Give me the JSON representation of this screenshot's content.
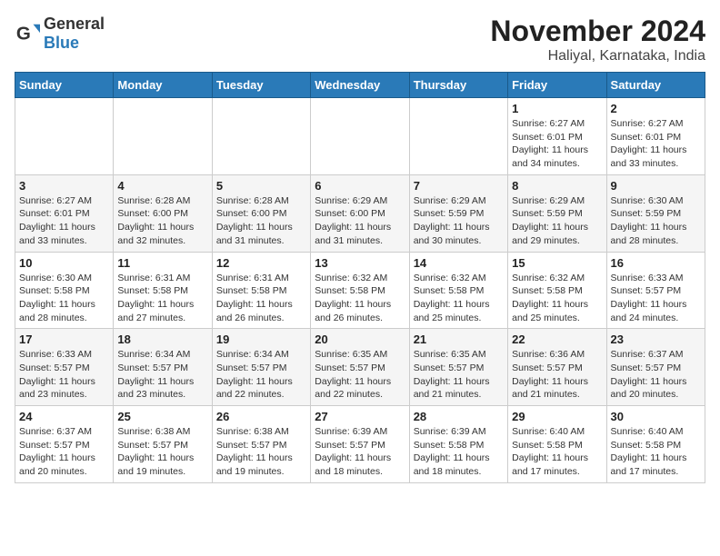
{
  "logo": {
    "text_general": "General",
    "text_blue": "Blue"
  },
  "title": "November 2024",
  "subtitle": "Haliyal, Karnataka, India",
  "weekdays": [
    "Sunday",
    "Monday",
    "Tuesday",
    "Wednesday",
    "Thursday",
    "Friday",
    "Saturday"
  ],
  "weeks": [
    [
      {
        "day": "",
        "info": ""
      },
      {
        "day": "",
        "info": ""
      },
      {
        "day": "",
        "info": ""
      },
      {
        "day": "",
        "info": ""
      },
      {
        "day": "",
        "info": ""
      },
      {
        "day": "1",
        "info": "Sunrise: 6:27 AM\nSunset: 6:01 PM\nDaylight: 11 hours and 34 minutes."
      },
      {
        "day": "2",
        "info": "Sunrise: 6:27 AM\nSunset: 6:01 PM\nDaylight: 11 hours and 33 minutes."
      }
    ],
    [
      {
        "day": "3",
        "info": "Sunrise: 6:27 AM\nSunset: 6:01 PM\nDaylight: 11 hours and 33 minutes."
      },
      {
        "day": "4",
        "info": "Sunrise: 6:28 AM\nSunset: 6:00 PM\nDaylight: 11 hours and 32 minutes."
      },
      {
        "day": "5",
        "info": "Sunrise: 6:28 AM\nSunset: 6:00 PM\nDaylight: 11 hours and 31 minutes."
      },
      {
        "day": "6",
        "info": "Sunrise: 6:29 AM\nSunset: 6:00 PM\nDaylight: 11 hours and 31 minutes."
      },
      {
        "day": "7",
        "info": "Sunrise: 6:29 AM\nSunset: 5:59 PM\nDaylight: 11 hours and 30 minutes."
      },
      {
        "day": "8",
        "info": "Sunrise: 6:29 AM\nSunset: 5:59 PM\nDaylight: 11 hours and 29 minutes."
      },
      {
        "day": "9",
        "info": "Sunrise: 6:30 AM\nSunset: 5:59 PM\nDaylight: 11 hours and 28 minutes."
      }
    ],
    [
      {
        "day": "10",
        "info": "Sunrise: 6:30 AM\nSunset: 5:58 PM\nDaylight: 11 hours and 28 minutes."
      },
      {
        "day": "11",
        "info": "Sunrise: 6:31 AM\nSunset: 5:58 PM\nDaylight: 11 hours and 27 minutes."
      },
      {
        "day": "12",
        "info": "Sunrise: 6:31 AM\nSunset: 5:58 PM\nDaylight: 11 hours and 26 minutes."
      },
      {
        "day": "13",
        "info": "Sunrise: 6:32 AM\nSunset: 5:58 PM\nDaylight: 11 hours and 26 minutes."
      },
      {
        "day": "14",
        "info": "Sunrise: 6:32 AM\nSunset: 5:58 PM\nDaylight: 11 hours and 25 minutes."
      },
      {
        "day": "15",
        "info": "Sunrise: 6:32 AM\nSunset: 5:58 PM\nDaylight: 11 hours and 25 minutes."
      },
      {
        "day": "16",
        "info": "Sunrise: 6:33 AM\nSunset: 5:57 PM\nDaylight: 11 hours and 24 minutes."
      }
    ],
    [
      {
        "day": "17",
        "info": "Sunrise: 6:33 AM\nSunset: 5:57 PM\nDaylight: 11 hours and 23 minutes."
      },
      {
        "day": "18",
        "info": "Sunrise: 6:34 AM\nSunset: 5:57 PM\nDaylight: 11 hours and 23 minutes."
      },
      {
        "day": "19",
        "info": "Sunrise: 6:34 AM\nSunset: 5:57 PM\nDaylight: 11 hours and 22 minutes."
      },
      {
        "day": "20",
        "info": "Sunrise: 6:35 AM\nSunset: 5:57 PM\nDaylight: 11 hours and 22 minutes."
      },
      {
        "day": "21",
        "info": "Sunrise: 6:35 AM\nSunset: 5:57 PM\nDaylight: 11 hours and 21 minutes."
      },
      {
        "day": "22",
        "info": "Sunrise: 6:36 AM\nSunset: 5:57 PM\nDaylight: 11 hours and 21 minutes."
      },
      {
        "day": "23",
        "info": "Sunrise: 6:37 AM\nSunset: 5:57 PM\nDaylight: 11 hours and 20 minutes."
      }
    ],
    [
      {
        "day": "24",
        "info": "Sunrise: 6:37 AM\nSunset: 5:57 PM\nDaylight: 11 hours and 20 minutes."
      },
      {
        "day": "25",
        "info": "Sunrise: 6:38 AM\nSunset: 5:57 PM\nDaylight: 11 hours and 19 minutes."
      },
      {
        "day": "26",
        "info": "Sunrise: 6:38 AM\nSunset: 5:57 PM\nDaylight: 11 hours and 19 minutes."
      },
      {
        "day": "27",
        "info": "Sunrise: 6:39 AM\nSunset: 5:57 PM\nDaylight: 11 hours and 18 minutes."
      },
      {
        "day": "28",
        "info": "Sunrise: 6:39 AM\nSunset: 5:58 PM\nDaylight: 11 hours and 18 minutes."
      },
      {
        "day": "29",
        "info": "Sunrise: 6:40 AM\nSunset: 5:58 PM\nDaylight: 11 hours and 17 minutes."
      },
      {
        "day": "30",
        "info": "Sunrise: 6:40 AM\nSunset: 5:58 PM\nDaylight: 11 hours and 17 minutes."
      }
    ]
  ]
}
